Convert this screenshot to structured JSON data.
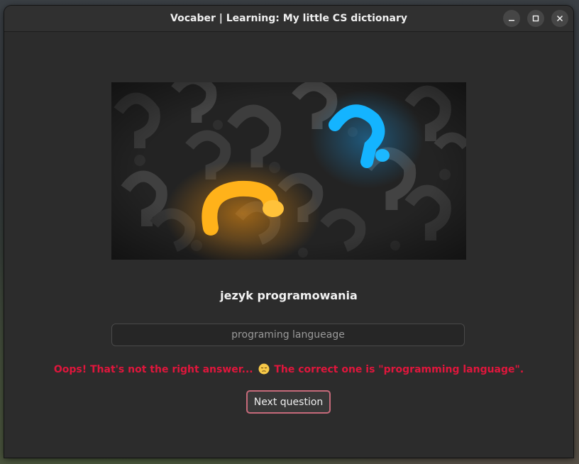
{
  "window": {
    "title": "Vocaber | Learning: My little CS dictionary",
    "controls": [
      {
        "name": "minimize",
        "icon": "minimize-icon"
      },
      {
        "name": "maximize",
        "icon": "maximize-icon"
      },
      {
        "name": "close",
        "icon": "close-icon"
      }
    ]
  },
  "image": {
    "icon": "question-marks-illustration",
    "accent_colors": {
      "orange": "#ffb21a",
      "blue": "#14b4ff",
      "dark": "#2a2a2a"
    }
  },
  "quiz": {
    "prompt": "jezyk programowania",
    "answer_value": "programing langueage",
    "feedback_before": "Oops! That's not the right answer...",
    "feedback_emoji": "pensive-face-icon",
    "feedback_after": "The correct one is \"programming language\".",
    "next_label": "Next question"
  },
  "colors": {
    "error": "#e0163c",
    "button_border": "#c66a7a",
    "window_bg": "#2c2c2c"
  }
}
